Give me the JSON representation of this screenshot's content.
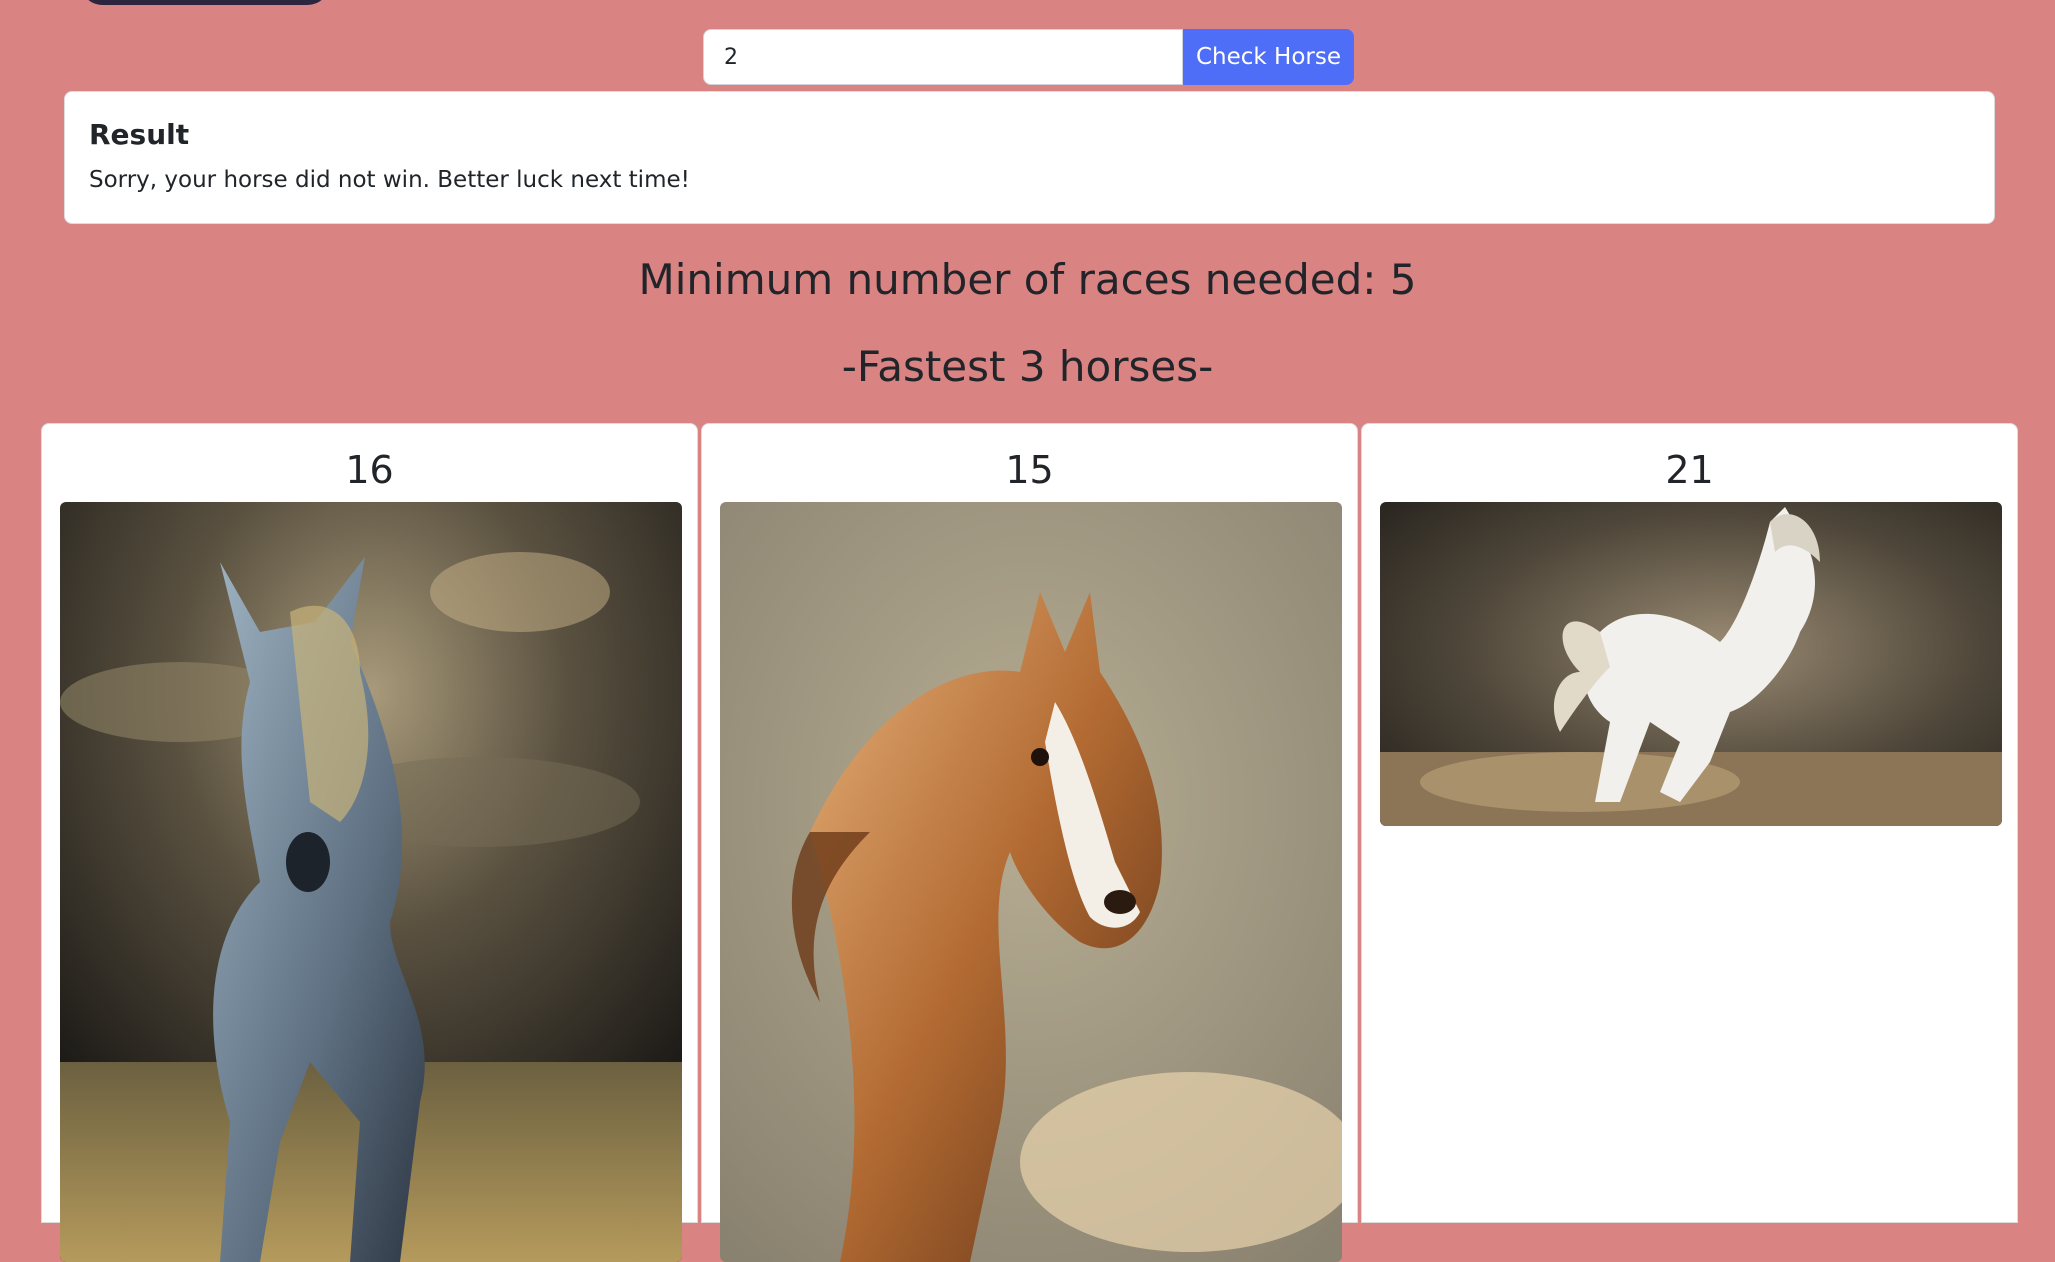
{
  "search": {
    "value": "2",
    "button_label": "Check Horse"
  },
  "result": {
    "title": "Result",
    "message": "Sorry, your horse did not win. Better luck next time!"
  },
  "races_heading": "Minimum number of races needed: 5",
  "fastest_heading": "-Fastest 3 horses-",
  "horses": [
    {
      "number": "16",
      "image_icon": "grey-horse-painting-icon"
    },
    {
      "number": "15",
      "image_icon": "chestnut-horse-painting-icon"
    },
    {
      "number": "21",
      "image_icon": "white-horse-photo-icon"
    }
  ],
  "colors": {
    "background": "#d98383",
    "button": "#4f6ef7"
  }
}
